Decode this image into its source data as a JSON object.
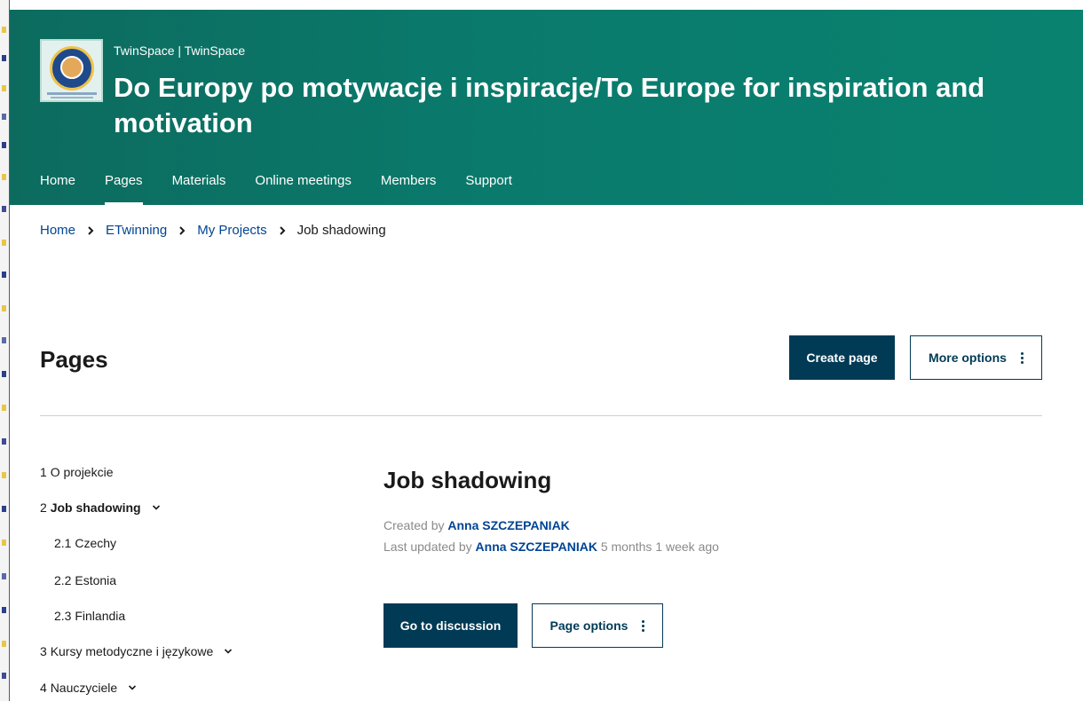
{
  "header": {
    "site_subtitle": "TwinSpace | TwinSpace",
    "title": "Do Europy po motywacje i inspiracje/To Europe for inspiration and motivation",
    "colors": {
      "header_start": "#0c6b5e",
      "header_end": "#0a8270",
      "primary_button": "#003a55",
      "link": "#004494"
    }
  },
  "nav": {
    "items": [
      {
        "label": "Home"
      },
      {
        "label": "Pages"
      },
      {
        "label": "Materials"
      },
      {
        "label": "Online meetings"
      },
      {
        "label": "Members"
      },
      {
        "label": "Support"
      }
    ],
    "active": "Pages"
  },
  "breadcrumb": {
    "items": [
      {
        "label": "Home"
      },
      {
        "label": "ETwinning"
      },
      {
        "label": "My Projects"
      },
      {
        "label": "Job shadowing"
      }
    ],
    "separator_icon": "chevron-right-icon"
  },
  "pages_header": {
    "heading": "Pages",
    "create_label": "Create page",
    "more_options_label": "More options"
  },
  "tree": {
    "items": [
      {
        "num": "1",
        "label": "O projekcie"
      },
      {
        "num": "2",
        "label": "Job shadowing"
      },
      {
        "num": "2.1",
        "label": "Czechy"
      },
      {
        "num": "2.2",
        "label": "Estonia"
      },
      {
        "num": "2.3",
        "label": "Finlandia"
      },
      {
        "num": "3",
        "label": "Kursy metodyczne i językowe"
      },
      {
        "num": "4",
        "label": "Nauczyciele"
      }
    ],
    "expand_icon": "chevron-down-icon"
  },
  "content": {
    "title": "Job shadowing",
    "created_prefix": "Created by",
    "created_by": "Anna SZCZEPANIAK",
    "updated_prefix": "Last updated by",
    "updated_by": "Anna SZCZEPANIAK",
    "updated_ago": "5 months 1 week ago",
    "discussion_label": "Go to discussion",
    "page_options_label": "Page options"
  }
}
